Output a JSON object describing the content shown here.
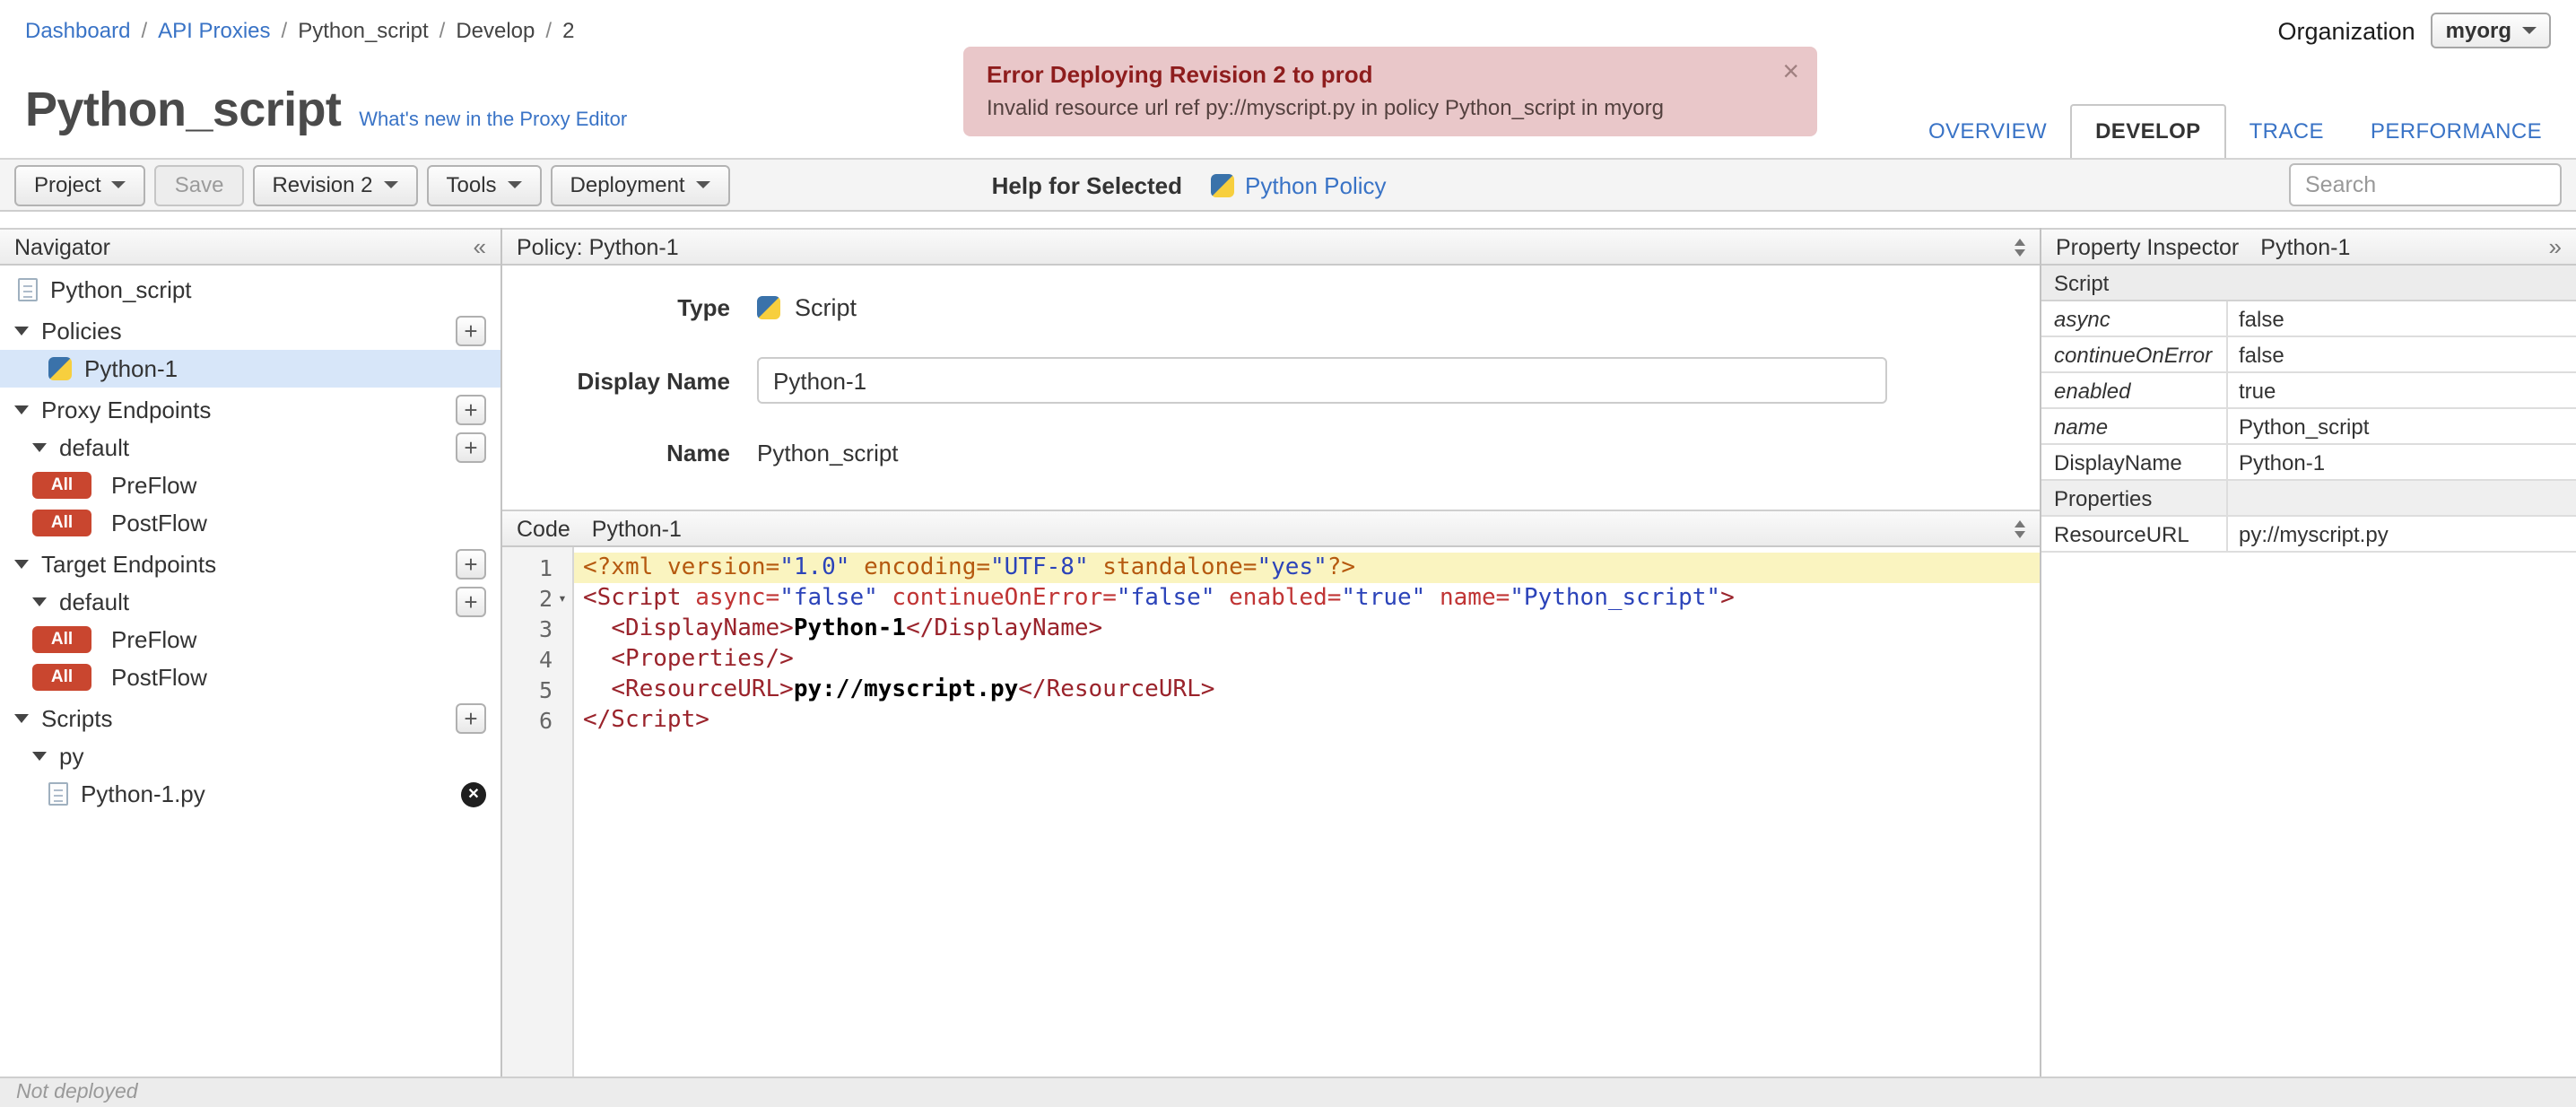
{
  "icons": {
    "collapse_left": "«",
    "collapse_right": "»",
    "plus": "+",
    "close": "×",
    "delete": "✕"
  },
  "breadcrumb": {
    "separator": "/",
    "items": [
      {
        "label": "Dashboard",
        "link": true
      },
      {
        "label": "API Proxies",
        "link": true
      },
      {
        "label": "Python_script",
        "link": false
      },
      {
        "label": "Develop",
        "link": false
      },
      {
        "label": "2",
        "link": false
      }
    ]
  },
  "org": {
    "label": "Organization",
    "value": "myorg"
  },
  "error_banner": {
    "title": "Error Deploying Revision 2 to prod",
    "message": "Invalid resource url ref py://myscript.py in policy Python_script in myorg"
  },
  "page": {
    "title": "Python_script",
    "whats_new_link": "What's new in the Proxy Editor"
  },
  "tabs": [
    {
      "label": "OVERVIEW",
      "active": false
    },
    {
      "label": "DEVELOP",
      "active": true
    },
    {
      "label": "TRACE",
      "active": false
    },
    {
      "label": "PERFORMANCE",
      "active": false
    }
  ],
  "toolbar": {
    "project": "Project",
    "save": "Save",
    "revision": "Revision 2",
    "tools": "Tools",
    "deployment": "Deployment",
    "help_for_selected": "Help for Selected",
    "policy_help_link": "Python Policy",
    "search_placeholder": "Search"
  },
  "navigator": {
    "title": "Navigator",
    "root_item": "Python_script",
    "policies": {
      "label": "Policies",
      "item": "Python-1"
    },
    "proxy_endpoints": {
      "label": "Proxy Endpoints",
      "group": "default",
      "flows": [
        {
          "badge": "All",
          "label": "PreFlow"
        },
        {
          "badge": "All",
          "label": "PostFlow"
        }
      ]
    },
    "target_endpoints": {
      "label": "Target Endpoints",
      "group": "default",
      "flows": [
        {
          "badge": "All",
          "label": "PreFlow"
        },
        {
          "badge": "All",
          "label": "PostFlow"
        }
      ]
    },
    "scripts": {
      "label": "Scripts",
      "group": "py",
      "file": "Python-1.py"
    }
  },
  "policy_panel": {
    "header": "Policy: Python-1",
    "type_label": "Type",
    "type_value": "Script",
    "display_name_label": "Display Name",
    "display_name_value": "Python-1",
    "name_label": "Name",
    "name_value": "Python_script",
    "code_label": "Code",
    "code_file": "Python-1"
  },
  "code": {
    "lines": [
      {
        "n": 1,
        "active": true,
        "tokens": [
          {
            "c": "pi",
            "t": "<?xml "
          },
          {
            "c": "pi",
            "t": "version="
          },
          {
            "c": "str",
            "t": "\"1.0\""
          },
          {
            "c": "pi",
            "t": " encoding="
          },
          {
            "c": "str",
            "t": "\"UTF-8\""
          },
          {
            "c": "pi",
            "t": " standalone="
          },
          {
            "c": "str",
            "t": "\"yes\""
          },
          {
            "c": "pi",
            "t": "?>"
          }
        ]
      },
      {
        "n": 2,
        "fold": true,
        "tokens": [
          {
            "c": "tag",
            "t": "<Script"
          },
          {
            "c": "attr",
            "t": " async="
          },
          {
            "c": "str",
            "t": "\"false\""
          },
          {
            "c": "attr",
            "t": " continueOnError="
          },
          {
            "c": "str",
            "t": "\"false\""
          },
          {
            "c": "attr",
            "t": " enabled="
          },
          {
            "c": "str",
            "t": "\"true\""
          },
          {
            "c": "attr",
            "t": " name="
          },
          {
            "c": "str",
            "t": "\"Python_script\""
          },
          {
            "c": "tag",
            "t": ">"
          }
        ]
      },
      {
        "n": 3,
        "tokens": [
          {
            "c": "plain",
            "t": "  "
          },
          {
            "c": "tag",
            "t": "<DisplayName>"
          },
          {
            "c": "txt",
            "t": "Python-1"
          },
          {
            "c": "tag",
            "t": "</DisplayName>"
          }
        ]
      },
      {
        "n": 4,
        "tokens": [
          {
            "c": "plain",
            "t": "  "
          },
          {
            "c": "tag",
            "t": "<Properties/>"
          }
        ]
      },
      {
        "n": 5,
        "tokens": [
          {
            "c": "plain",
            "t": "  "
          },
          {
            "c": "tag",
            "t": "<ResourceURL>"
          },
          {
            "c": "txt",
            "t": "py://myscript.py"
          },
          {
            "c": "tag",
            "t": "</ResourceURL>"
          }
        ]
      },
      {
        "n": 6,
        "tokens": [
          {
            "c": "tag",
            "t": "</Script>"
          }
        ]
      }
    ]
  },
  "inspector": {
    "title": "Property Inspector",
    "subtitle": "Python-1",
    "section": "Script",
    "rows": [
      {
        "name": "async",
        "value": "false",
        "italic": true
      },
      {
        "name": "continueOnError",
        "value": "false",
        "italic": true
      },
      {
        "name": "enabled",
        "value": "true",
        "italic": true
      },
      {
        "name": "name",
        "value": "Python_script",
        "italic": true
      },
      {
        "name": "DisplayName",
        "value": "Python-1",
        "italic": false
      },
      {
        "name": "Properties",
        "value": "",
        "italic": false,
        "shaded": true
      },
      {
        "name": "ResourceURL",
        "value": "py://myscript.py",
        "italic": false
      }
    ]
  },
  "statusbar": {
    "text": "Not deployed"
  }
}
